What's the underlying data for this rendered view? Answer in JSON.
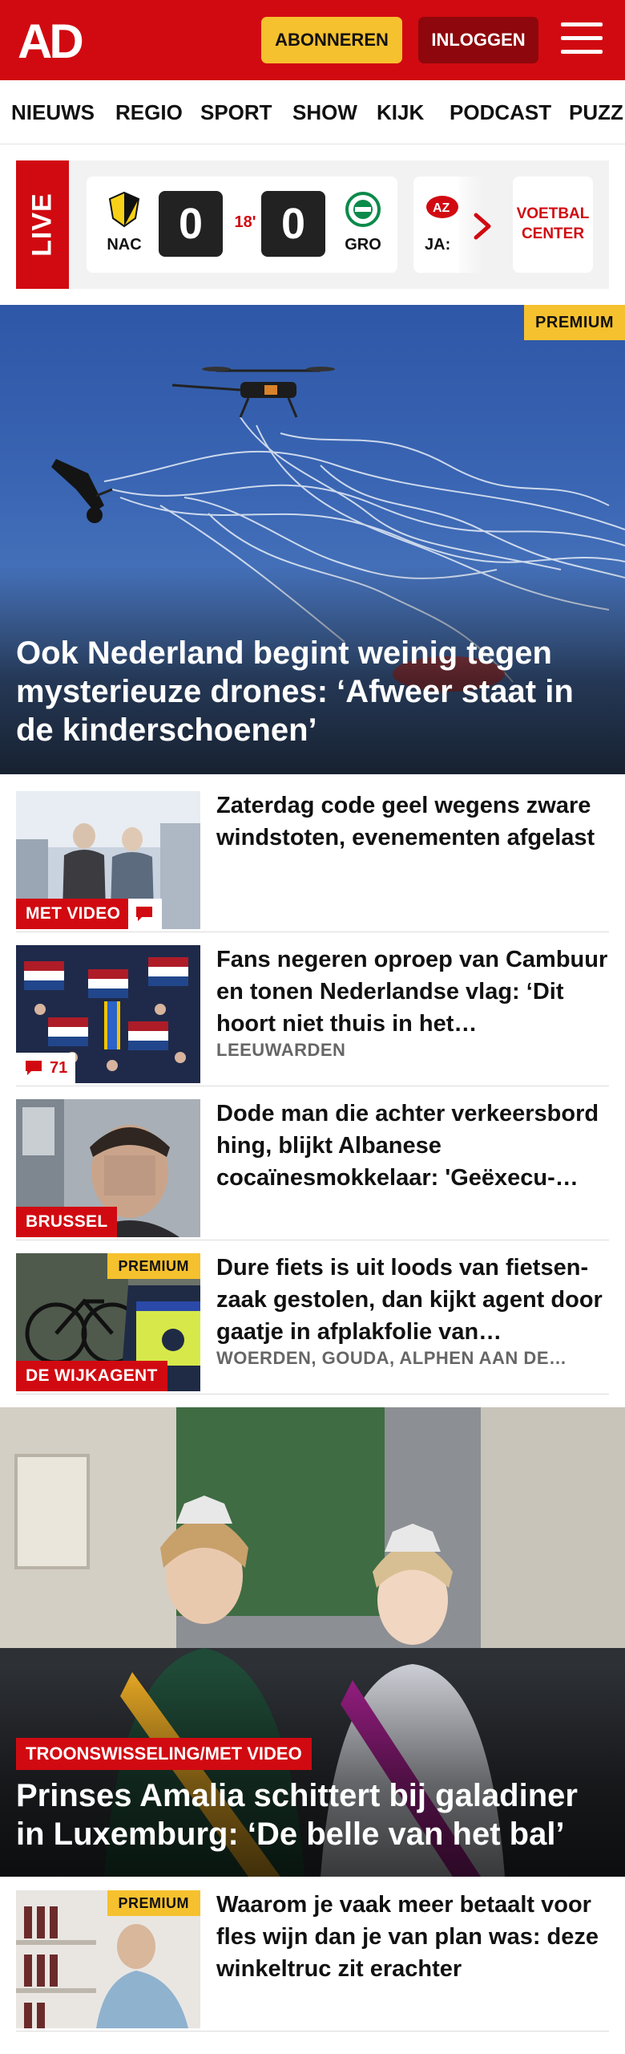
{
  "header": {
    "logo_text": "AD",
    "subscribe_label": "ABONNEREN",
    "login_label": "INLOGGEN",
    "menu_icon": "hamburger-icon",
    "brand_color": "#d10a11"
  },
  "nav": {
    "items": [
      "NIEUWS",
      "REGIO",
      "SPORT",
      "SHOW",
      "KIJK",
      "PODCAST",
      "PUZZ"
    ]
  },
  "live": {
    "label": "LIVE",
    "match": {
      "home": "NAC",
      "away": "GRO",
      "home_score": "0",
      "away_score": "0",
      "minute": "18'"
    },
    "next_match_team": "JA:",
    "voetbal_center_label": "VOETBAL CENTER"
  },
  "hero": {
    "badge": "PREMIUM",
    "title": "Ook Nederland begint weinig tegen mysterieuze drones: ‘Afweer staat in de kinderschoenen’"
  },
  "articles": [
    {
      "title": "Zaterdag code geel wegens zware windstoten, evenementen afgelast",
      "label": "MET VIDEO",
      "meta": "",
      "comments": ""
    },
    {
      "title": "Fans negeren oproep van Cambuur en tonen Nederlandse vlag: ‘Dit hoort niet thuis in het…",
      "label": "",
      "meta": "LEEUWARDEN",
      "comments": "71"
    },
    {
      "title": "Dode man die achter verkeers­bord hing, blijkt Albanese cocaïnesmokkelaar: 'Geëxecu-…",
      "label": "BRUSSEL",
      "meta": "",
      "comments": ""
    },
    {
      "title": "Dure fiets is uit loods van fietsen­zaak gestolen, dan kijkt agent door gaatje in afplakfolie van…",
      "label": "DE WIJKAGENT",
      "badge": "PREMIUM",
      "meta": "WOERDEN, GOUDA, ALPHEN AAN DE…",
      "comments": ""
    }
  ],
  "feature": {
    "label": "TROONSWISSELING/MET VIDEO",
    "title": "Prinses Amalia schittert bij galadiner in Luxemburg: ‘De belle van het bal’"
  },
  "article_after": {
    "badge": "PREMIUM",
    "title": "Waarom je vaak meer betaalt voor fles wijn dan je van plan was: deze winkeltruc zit erachter"
  }
}
